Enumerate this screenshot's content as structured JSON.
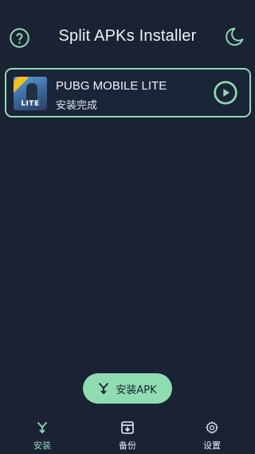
{
  "header": {
    "title": "Split APKs Installer",
    "help_icon": "help-circle-icon",
    "theme_icon": "moon-icon"
  },
  "app_card": {
    "name": "PUBG MOBILE LITE",
    "status": "安装完成",
    "icon_text": "LITE",
    "action_icon": "play-circle-icon"
  },
  "install_button": {
    "label": "安装APK",
    "icon": "merge-arrow-icon"
  },
  "nav": {
    "items": [
      {
        "label": "安装",
        "icon": "merge-arrow-icon",
        "active": true
      },
      {
        "label": "备份",
        "icon": "archive-icon",
        "active": false
      },
      {
        "label": "设置",
        "icon": "gear-icon",
        "active": false
      }
    ]
  },
  "colors": {
    "background": "#1a2233",
    "accent": "#8fdcb1",
    "text": "#eef2f8"
  }
}
